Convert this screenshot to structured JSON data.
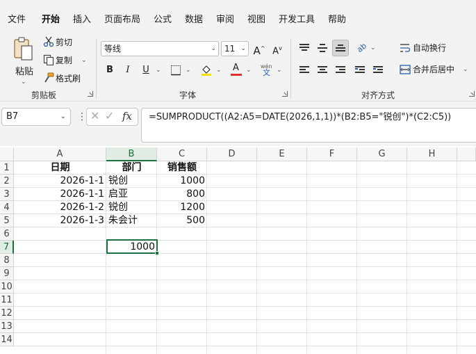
{
  "menu": {
    "file": "文件",
    "home": "开始",
    "insert": "插入",
    "page_layout": "页面布局",
    "formulas": "公式",
    "data": "数据",
    "review": "审阅",
    "view": "视图",
    "developer": "开发工具",
    "help": "帮助"
  },
  "ribbon": {
    "clipboard": {
      "paste": "粘贴",
      "cut": "剪切",
      "copy": "复制",
      "format_painter": "格式刷",
      "group_label": "剪贴板"
    },
    "font": {
      "font_name": "等线",
      "font_size": "11",
      "grow": "A",
      "shrink": "A",
      "bold": "B",
      "italic": "I",
      "underline": "U",
      "highlight_letter": "A",
      "font_color_letter": "A",
      "phonetic_top": "wén",
      "phonetic_bottom": "文",
      "group_label": "字体",
      "highlight_color": "#f5e400",
      "font_color": "#e03030"
    },
    "alignment": {
      "wrap_text": "自动换行",
      "merge_center": "合并后居中",
      "group_label": "对齐方式"
    }
  },
  "formula_bar": {
    "name_box": "B7",
    "fx": "fx",
    "formula": "=SUMPRODUCT((A2:A5=DATE(2026,1,1))*(B2:B5=\"锐创\")*(C2:C5))"
  },
  "sheet": {
    "columns": [
      "A",
      "B",
      "C",
      "D",
      "E",
      "F",
      "G",
      "H"
    ],
    "rows": [
      "1",
      "2",
      "3",
      "4",
      "5",
      "6",
      "7",
      "8",
      "9",
      "10",
      "11",
      "12",
      "13",
      "14"
    ],
    "headers": {
      "date": "日期",
      "dept": "部门",
      "sales": "销售额"
    },
    "data": [
      {
        "date": "2026-1-1",
        "dept": "锐创",
        "sales": "1000"
      },
      {
        "date": "2026-1-1",
        "dept": "启亚",
        "sales": "800"
      },
      {
        "date": "2026-1-2",
        "dept": "锐创",
        "sales": "1200"
      },
      {
        "date": "2026-1-3",
        "dept": "朱会计",
        "sales": "500"
      }
    ],
    "result": "1000",
    "accent_color": "#1e6e41"
  }
}
